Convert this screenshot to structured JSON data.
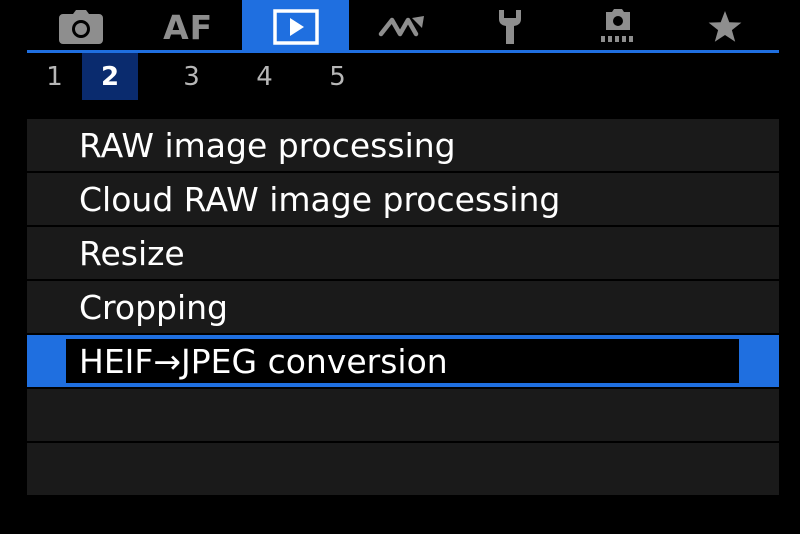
{
  "main_tabs": [
    {
      "id": "shooting",
      "icon": "camera-icon",
      "label": "",
      "active": false
    },
    {
      "id": "af",
      "icon": "",
      "label": "AF",
      "active": false
    },
    {
      "id": "playback",
      "icon": "play-icon",
      "label": "",
      "active": true
    },
    {
      "id": "wireless",
      "icon": "wireless-icon",
      "label": "",
      "active": false
    },
    {
      "id": "setup",
      "icon": "wrench-icon",
      "label": "",
      "active": false
    },
    {
      "id": "custom",
      "icon": "custom-functions-icon",
      "label": "",
      "active": false
    },
    {
      "id": "mymenu",
      "icon": "star-icon",
      "label": "",
      "active": false
    }
  ],
  "sub_tabs": [
    "1",
    "2",
    "3",
    "4",
    "5"
  ],
  "active_sub_tab": "2",
  "menu": {
    "items": [
      "RAW image processing",
      "Cloud RAW image processing",
      "Resize",
      "Cropping",
      "HEIF→JPEG conversion",
      "",
      ""
    ],
    "selected_index": 4
  },
  "colors": {
    "accent": "#1f6fe0",
    "sub_tab_active": "#0a2b6e",
    "row_bg": "#1a1a1a",
    "icon_gray": "#8e8e8e"
  }
}
